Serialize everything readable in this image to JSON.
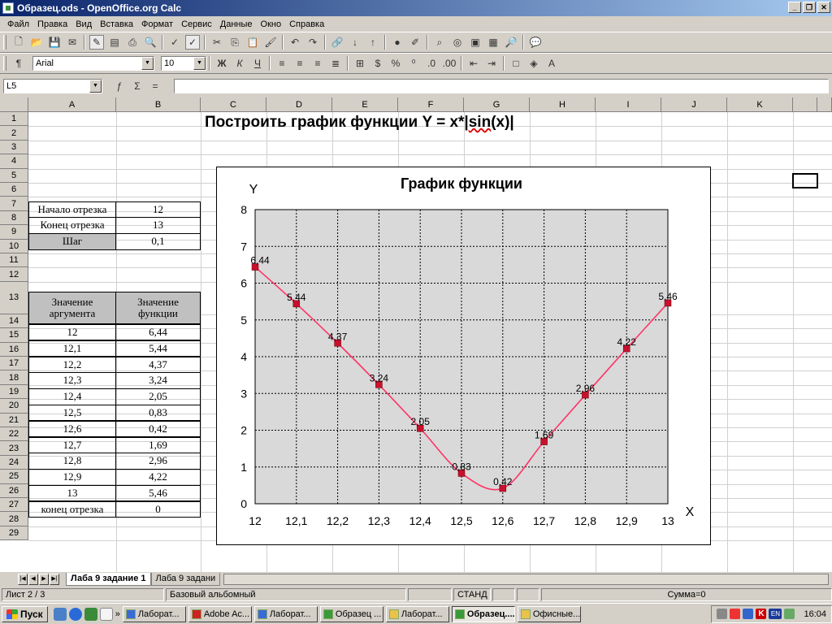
{
  "window": {
    "title": "Образец.ods - OpenOffice.org Calc"
  },
  "menu": [
    "Файл",
    "Правка",
    "Вид",
    "Вставка",
    "Формат",
    "Сервис",
    "Данные",
    "Окно",
    "Справка"
  ],
  "format_toolbar": {
    "font": "Arial",
    "size": "10"
  },
  "formula_bar": {
    "cell_ref": "L5",
    "content": ""
  },
  "columns": [
    "A",
    "B",
    "C",
    "D",
    "E",
    "F",
    "G",
    "H",
    "I",
    "J",
    "K"
  ],
  "rows": [
    "1",
    "2",
    "3",
    "4",
    "5",
    "6",
    "7",
    "8",
    "9",
    "10",
    "11",
    "12",
    "13",
    "14",
    "15",
    "16",
    "17",
    "18",
    "19",
    "20",
    "21",
    "22",
    "23",
    "24",
    "25",
    "26",
    "27",
    "28",
    "29"
  ],
  "sheet": {
    "title_main": "Построить график функции Y = x*|",
    "title_sin": "sin",
    "title_rest": "(x)|",
    "params": [
      {
        "label": "Начало отрезка",
        "value": "12"
      },
      {
        "label": "Конец отрезка",
        "value": "13"
      },
      {
        "label": "Шаг",
        "value": "0,1"
      }
    ],
    "table_header": {
      "arg": "Значение аргумента",
      "fn": "Значение функции"
    },
    "table_rows": [
      {
        "x": "12",
        "y": "6,44"
      },
      {
        "x": "12,1",
        "y": "5,44"
      },
      {
        "x": "12,2",
        "y": "4,37"
      },
      {
        "x": "12,3",
        "y": "3,24"
      },
      {
        "x": "12,4",
        "y": "2,05"
      },
      {
        "x": "12,5",
        "y": "0,83"
      },
      {
        "x": "12,6",
        "y": "0,42"
      },
      {
        "x": "12,7",
        "y": "1,69"
      },
      {
        "x": "12,8",
        "y": "2,96"
      },
      {
        "x": "12,9",
        "y": "4,22"
      },
      {
        "x": "13",
        "y": "5,46"
      },
      {
        "x": "конец отрезка",
        "y": "0"
      }
    ]
  },
  "chart_data": {
    "type": "line",
    "title": "График функции",
    "xlabel": "X",
    "ylabel": "Y",
    "x": [
      12,
      12.1,
      12.2,
      12.3,
      12.4,
      12.5,
      12.6,
      12.7,
      12.8,
      12.9,
      13
    ],
    "series": [
      {
        "values": [
          6.44,
          5.44,
          4.37,
          3.24,
          2.05,
          0.83,
          0.42,
          1.69,
          2.96,
          4.22,
          5.46
        ]
      }
    ],
    "data_labels": [
      "6,44",
      "5,44",
      "4,37",
      "3,24",
      "2,05",
      "0,83",
      "0,42",
      "1,69",
      "2,96",
      "4,22",
      "5,46"
    ],
    "x_ticks": [
      "12",
      "12,1",
      "12,2",
      "12,3",
      "12,4",
      "12,5",
      "12,6",
      "12,7",
      "12,8",
      "12,9",
      "13"
    ],
    "y_ticks": [
      "0",
      "1",
      "2",
      "3",
      "4",
      "5",
      "6",
      "7",
      "8"
    ],
    "xlim": [
      12,
      13
    ],
    "ylim": [
      0,
      8
    ],
    "grid": true,
    "colors": {
      "line": "#ff3366",
      "marker": "#c8102e",
      "plot_bg": "#d9d9d9"
    }
  },
  "tabs": [
    "Лаба 9 задание 1",
    "Лаба 9 задани"
  ],
  "status": {
    "sheet": "Лист 2 / 3",
    "style": "Базовый альбомный",
    "mode": "СТАНД",
    "sum": "Сумма=0"
  },
  "taskbar": {
    "start": "Пуск",
    "tasks": [
      "Лаборат...",
      "Adobe Ac...",
      "Лаборат...",
      "Образец ...",
      "Лаборат...",
      "Образец....",
      "Офисные..."
    ],
    "active_index": 5,
    "lang": "EN",
    "time": "16:04"
  }
}
